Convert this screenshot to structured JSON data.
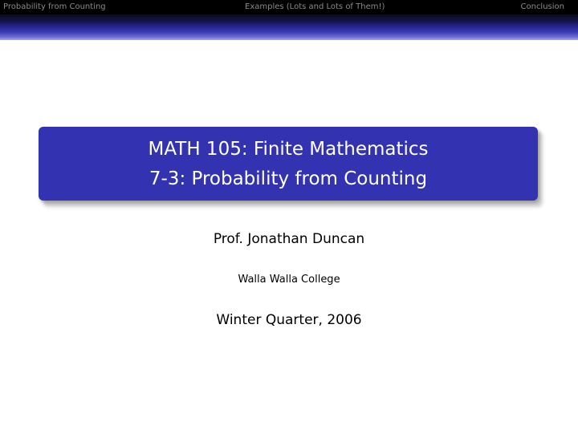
{
  "navigation": {
    "items": [
      {
        "label": "Probability from Counting"
      },
      {
        "label": "Examples (Lots and Lots of Them!)"
      },
      {
        "label": "Conclusion"
      }
    ]
  },
  "title_slide": {
    "title_line1": "MATH 105: Finite Mathematics",
    "title_line2": "7-3: Probability from Counting",
    "author": "Prof. Jonathan Duncan",
    "institute": "Walla Walla College",
    "date": "Winter Quarter, 2006"
  },
  "colors": {
    "nav_background": "#000000",
    "nav_text": "#8a8a8a",
    "title_box": "#3333b2",
    "title_text": "#ffffff"
  }
}
